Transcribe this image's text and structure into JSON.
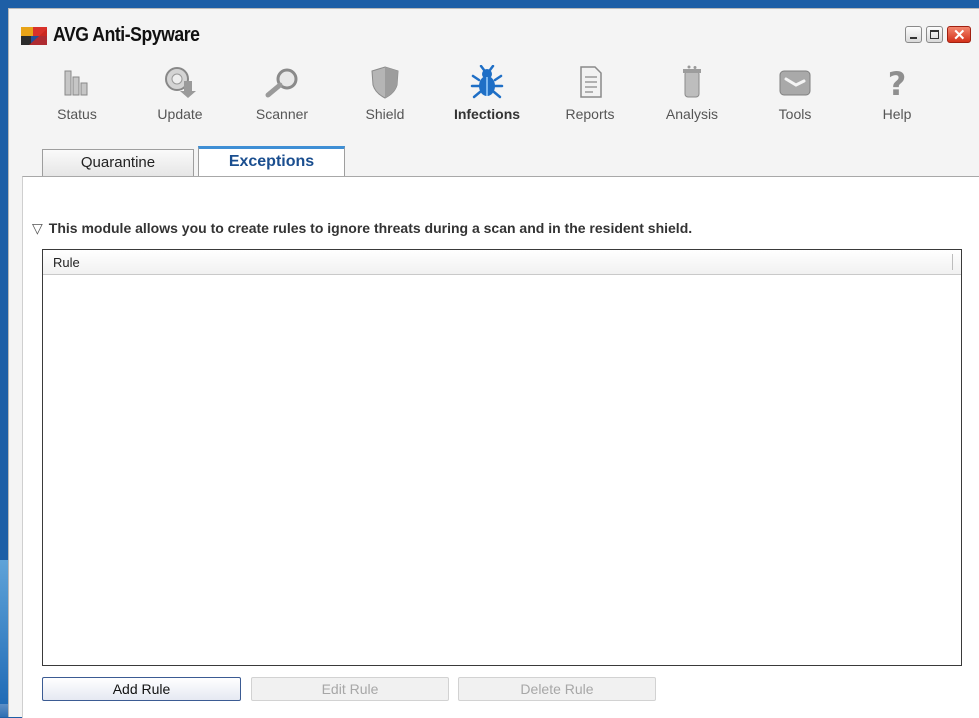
{
  "window": {
    "title": "AVG Anti-Spyware",
    "controls": {
      "minimize": "minimize",
      "maximize": "maximize",
      "close": "✕"
    }
  },
  "toolbar": {
    "items": [
      {
        "label": "Status",
        "icon": "status-icon"
      },
      {
        "label": "Update",
        "icon": "update-icon"
      },
      {
        "label": "Scanner",
        "icon": "scanner-icon"
      },
      {
        "label": "Shield",
        "icon": "shield-icon"
      },
      {
        "label": "Infections",
        "icon": "infections-icon",
        "active": true
      },
      {
        "label": "Reports",
        "icon": "reports-icon"
      },
      {
        "label": "Analysis",
        "icon": "analysis-icon"
      },
      {
        "label": "Tools",
        "icon": "tools-icon"
      },
      {
        "label": "Help",
        "icon": "help-icon"
      }
    ]
  },
  "tabs": [
    {
      "label": "Quarantine",
      "active": false
    },
    {
      "label": "Exceptions",
      "active": true
    }
  ],
  "exceptions": {
    "description": "This module allows you to create rules to ignore threats during a scan and in the resident shield.",
    "table": {
      "columns": [
        "Rule"
      ],
      "rows": []
    },
    "buttons": {
      "add": "Add Rule",
      "edit": "Edit Rule",
      "delete": "Delete Rule"
    }
  },
  "colors": {
    "accent": "#3f8fd5",
    "active_tab_text": "#1a4e8f",
    "infections_icon": "#1f6fc6",
    "close_button": "#d3311a"
  }
}
